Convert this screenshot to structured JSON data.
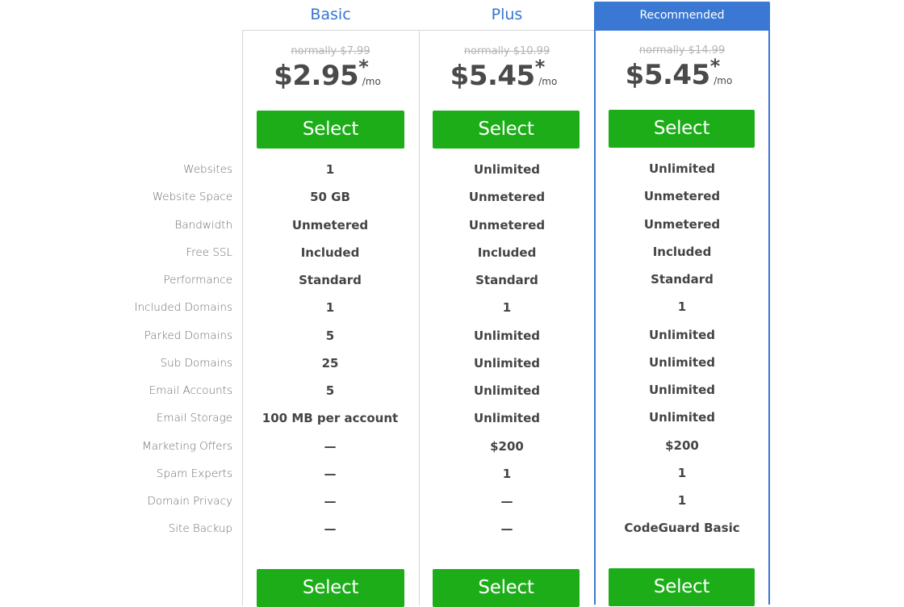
{
  "plans": [
    {
      "name": "Basic",
      "normally": "normally $7.99",
      "price": "$2.95",
      "asterisk": "*",
      "per": "/mo",
      "select_label": "Select",
      "select_bottom_label": "Select"
    },
    {
      "name": "Plus",
      "normally": "normally $10.99",
      "price": "$5.45",
      "asterisk": "*",
      "per": "/mo",
      "select_label": "Select",
      "select_bottom_label": "Select"
    },
    {
      "name": "Recommended",
      "normally": "normally $14.99",
      "price": "$5.45",
      "asterisk": "*",
      "per": "/mo",
      "select_label": "Select",
      "select_bottom_label": "Select"
    }
  ],
  "features": [
    {
      "label": "Websites",
      "values": [
        "1",
        "Unlimited",
        "Unlimited"
      ]
    },
    {
      "label": "Website Space",
      "values": [
        "50 GB",
        "Unmetered",
        "Unmetered"
      ]
    },
    {
      "label": "Bandwidth",
      "values": [
        "Unmetered",
        "Unmetered",
        "Unmetered"
      ]
    },
    {
      "label": "Free SSL",
      "values": [
        "Included",
        "Included",
        "Included"
      ]
    },
    {
      "label": "Performance",
      "values": [
        "Standard",
        "Standard",
        "Standard"
      ]
    },
    {
      "label": "Included Domains",
      "values": [
        "1",
        "1",
        "1"
      ]
    },
    {
      "label": "Parked Domains",
      "values": [
        "5",
        "Unlimited",
        "Unlimited"
      ]
    },
    {
      "label": "Sub Domains",
      "values": [
        "25",
        "Unlimited",
        "Unlimited"
      ]
    },
    {
      "label": "Email Accounts",
      "values": [
        "5",
        "Unlimited",
        "Unlimited"
      ]
    },
    {
      "label": "Email Storage",
      "values": [
        "100 MB per account",
        "Unlimited",
        "Unlimited"
      ]
    },
    {
      "label": "Marketing Offers",
      "values": [
        "—",
        "$200",
        "$200"
      ]
    },
    {
      "label": "Spam Experts",
      "values": [
        "—",
        "1",
        "1"
      ]
    },
    {
      "label": "Domain Privacy",
      "values": [
        "—",
        "—",
        "1"
      ]
    },
    {
      "label": "Site Backup",
      "values": [
        "—",
        "—",
        "CodeGuard Basic"
      ]
    }
  ],
  "colors": {
    "accent": "#3a78d4",
    "button": "#1cad19",
    "text": "#444444",
    "label": "#6d6d6d",
    "strike": "#b5b5b5"
  }
}
